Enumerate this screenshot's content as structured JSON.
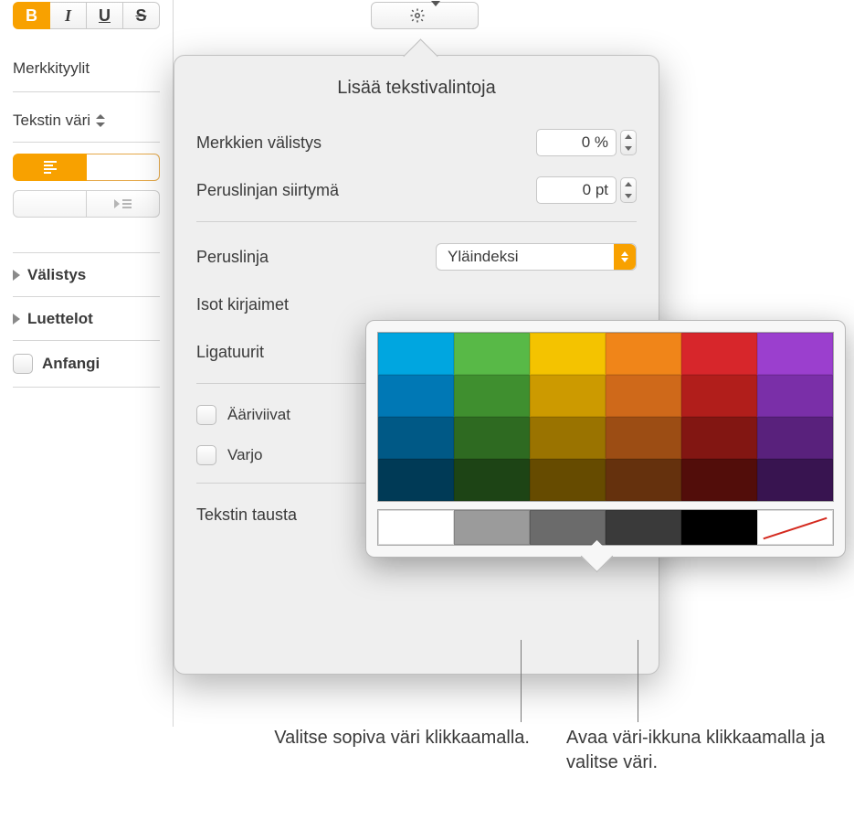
{
  "toolbar": {
    "bold": "B",
    "italic": "I",
    "underline": "U",
    "strike": "S"
  },
  "sidebar": {
    "char_styles_label": "Merkkityylit",
    "text_color_label": "Tekstin väri",
    "spacing_label": "Välistys",
    "lists_label": "Luettelot",
    "dropcap_label": "Anfangi"
  },
  "popover": {
    "title": "Lisää tekstivalintoja",
    "char_spacing_label": "Merkkien välistys",
    "char_spacing_value": "0 %",
    "baseline_shift_label": "Peruslinjan siirtymä",
    "baseline_shift_value": "0 pt",
    "baseline_label": "Peruslinja",
    "baseline_selected": "Yläindeksi",
    "caps_label": "Isot kirjaimet",
    "ligatures_label": "Ligatuurit",
    "outlines_label": "Ääriviivat",
    "shadow_label": "Varjo",
    "text_background_label": "Tekstin tausta"
  },
  "palette": {
    "rows": [
      [
        "#00a6e0",
        "#58b947",
        "#f4c300",
        "#f08519",
        "#d7262b",
        "#9b3fce"
      ],
      [
        "#0078b5",
        "#3f8f2f",
        "#cc9a00",
        "#cf691a",
        "#b11e1b",
        "#7a2fa8"
      ],
      [
        "#005986",
        "#2e6a21",
        "#9a7300",
        "#9c4d14",
        "#821612",
        "#59217c"
      ],
      [
        "#003a56",
        "#1d4415",
        "#664b00",
        "#65310d",
        "#520d0a",
        "#381450"
      ]
    ],
    "neutral": [
      "#ffffff",
      "#9b9b9b",
      "#6b6b6b",
      "#3a3a3a",
      "#000000",
      "none"
    ]
  },
  "callouts": {
    "left": "Valitse sopiva väri klikkaamalla.",
    "right": "Avaa väri-ikkuna klikkaamalla ja valitse väri."
  }
}
